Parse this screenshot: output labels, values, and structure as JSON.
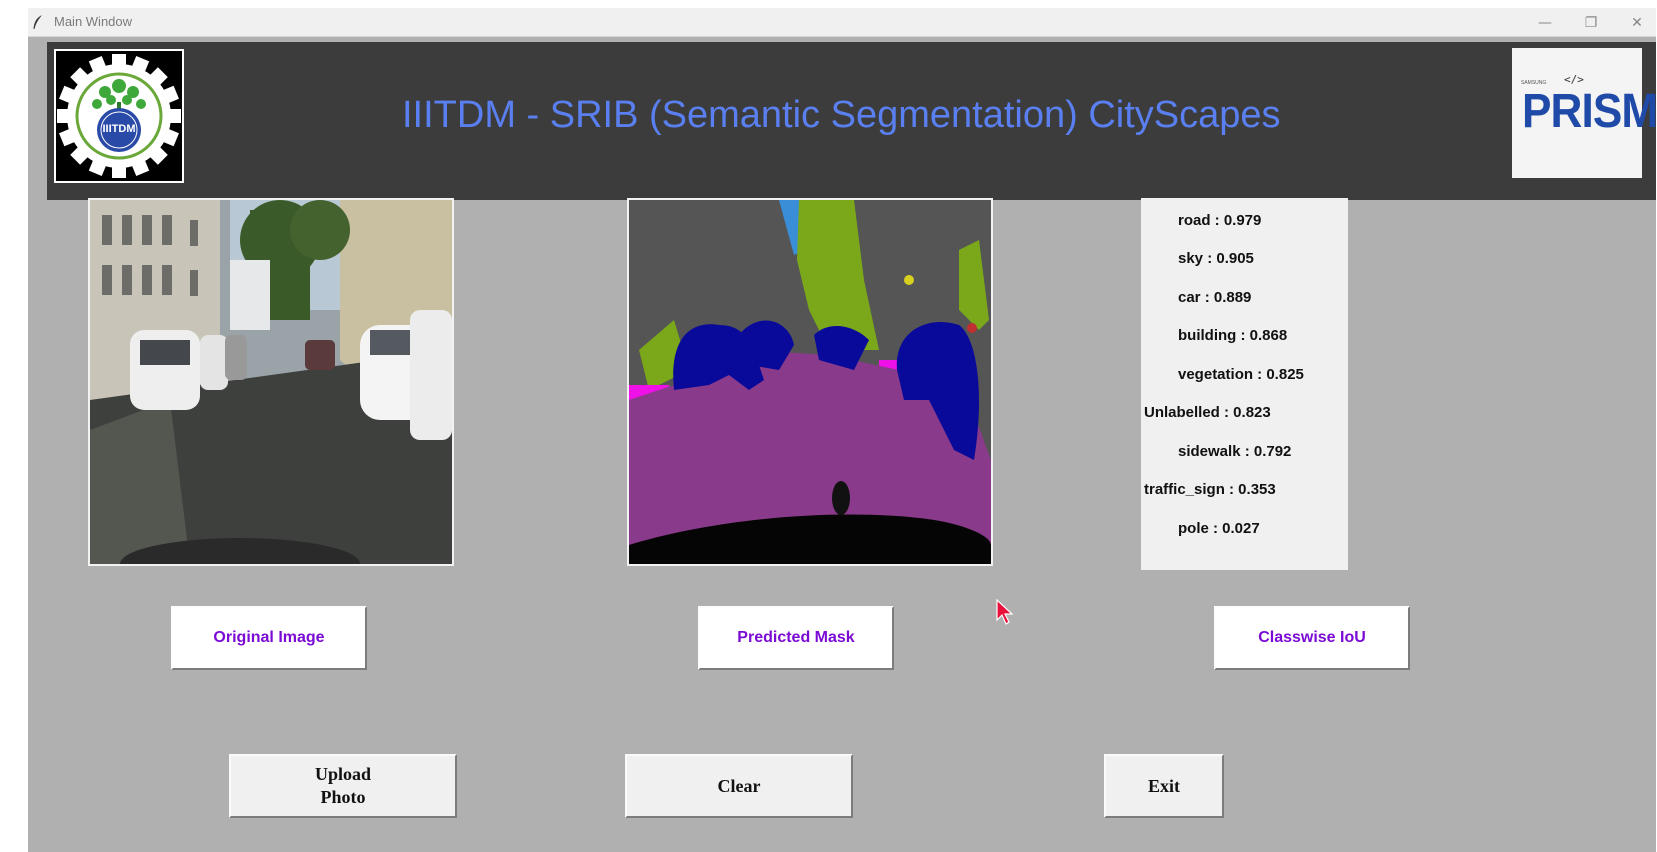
{
  "window": {
    "title": "Main Window",
    "controls": {
      "minimize": "—",
      "restore": "❐",
      "close": "✕"
    }
  },
  "header": {
    "title": "IIITDM - SRIB (Semantic Segmentation) CityScapes",
    "left_logo_text": "IIITDM",
    "right_logo": {
      "brand": "PRISM",
      "small": "SAMSUNG",
      "code": "</>"
    },
    "title_color": "#5a7ff0",
    "background": "#3c3c3c"
  },
  "classwise_iou": [
    {
      "label": "road : 0.979"
    },
    {
      "label": "sky : 0.905"
    },
    {
      "label": "car : 0.889"
    },
    {
      "label": "building : 0.868"
    },
    {
      "label": "vegetation : 0.825"
    },
    {
      "label": "Unlabelled : 0.823"
    },
    {
      "label": "sidewalk : 0.792"
    },
    {
      "label": "traffic_sign : 0.353"
    },
    {
      "label": "pole : 0.027"
    }
  ],
  "labels": {
    "original": "Original Image",
    "predicted": "Predicted Mask",
    "classwise": "Classwise IoU"
  },
  "buttons": {
    "upload": "Upload\nPhoto",
    "clear": "Clear",
    "exit": "Exit"
  },
  "colors": {
    "label_text": "#7b0bd4",
    "background": "#b0b0b0",
    "mask_road": "#8a3a8a",
    "mask_car": "#0a0a9a",
    "mask_vegetation": "#7aa81a",
    "mask_sky": "#3a8ed8",
    "mask_sidewalk": "#f010e8",
    "mask_building": "#555555"
  }
}
